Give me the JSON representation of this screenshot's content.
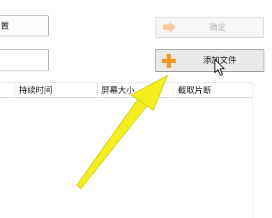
{
  "top_left_button": {
    "label": "置"
  },
  "confirm_button": {
    "label": "确定",
    "icon": "arrow-right-icon"
  },
  "add_file_button": {
    "label": "添加文件",
    "icon": "plus-icon"
  },
  "table": {
    "columns": [
      "持续时间",
      "屏幕大小",
      "截取片断"
    ]
  },
  "colors": {
    "annotation_arrow": "#f2ef1c",
    "plus_icon": "#f39a28",
    "confirm_icon": "#f7c9a0"
  }
}
